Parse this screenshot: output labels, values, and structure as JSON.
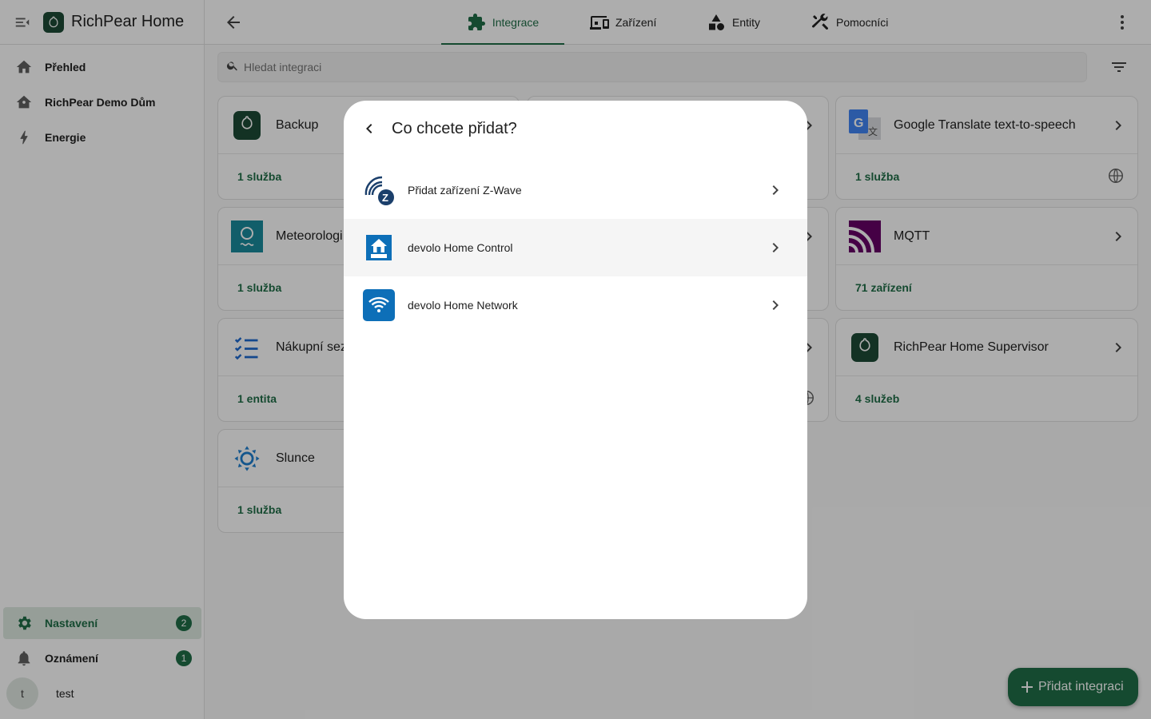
{
  "app": {
    "title": "RichPear Home"
  },
  "sidebar": {
    "items": [
      {
        "label": "Přehled",
        "icon": "home-icon"
      },
      {
        "label": "RichPear Demo Dům",
        "icon": "home-outline-icon"
      },
      {
        "label": "Energie",
        "icon": "lightning-icon"
      }
    ],
    "bottom": [
      {
        "label": "Nastavení",
        "icon": "gear-icon",
        "badge": "2"
      },
      {
        "label": "Oznámení",
        "icon": "bell-icon",
        "badge": "1"
      }
    ],
    "user": {
      "initial": "t",
      "name": "test"
    }
  },
  "tabs": [
    {
      "label": "Integrace",
      "icon": "puzzle-icon",
      "active": true
    },
    {
      "label": "Zařízení",
      "icon": "devices-icon"
    },
    {
      "label": "Entity",
      "icon": "shapes-icon"
    },
    {
      "label": "Pomocníci",
      "icon": "tools-icon"
    }
  ],
  "search": {
    "placeholder": "Hledat integraci"
  },
  "cards": [
    {
      "name": "Backup",
      "footer": "1 služba"
    },
    {
      "name": "Meteorologi",
      "footer": "1 služba"
    },
    {
      "name": "Nákupní sez",
      "footer": "1 entita"
    },
    {
      "name": "Slunce",
      "footer": "1 služba"
    },
    {
      "name": "Google Translate text-to-speech",
      "footer": "1 služba"
    },
    {
      "name": "MQTT",
      "footer": "71 zařízení"
    },
    {
      "name": "RichPear Home Supervisor",
      "footer": "4 služeb"
    }
  ],
  "dialog": {
    "title": "Co chcete přidat?",
    "items": [
      {
        "label": "Přidat zařízení Z-Wave",
        "icon": "zwave-icon"
      },
      {
        "label": "devolo Home Control",
        "icon": "devolo-home-icon"
      },
      {
        "label": "devolo Home Network",
        "icon": "devolo-wifi-icon"
      }
    ]
  },
  "fab": {
    "label": "Přidat integraci"
  },
  "colors": {
    "accent": "#1f6e47",
    "brand_dark": "#1d4a35"
  }
}
